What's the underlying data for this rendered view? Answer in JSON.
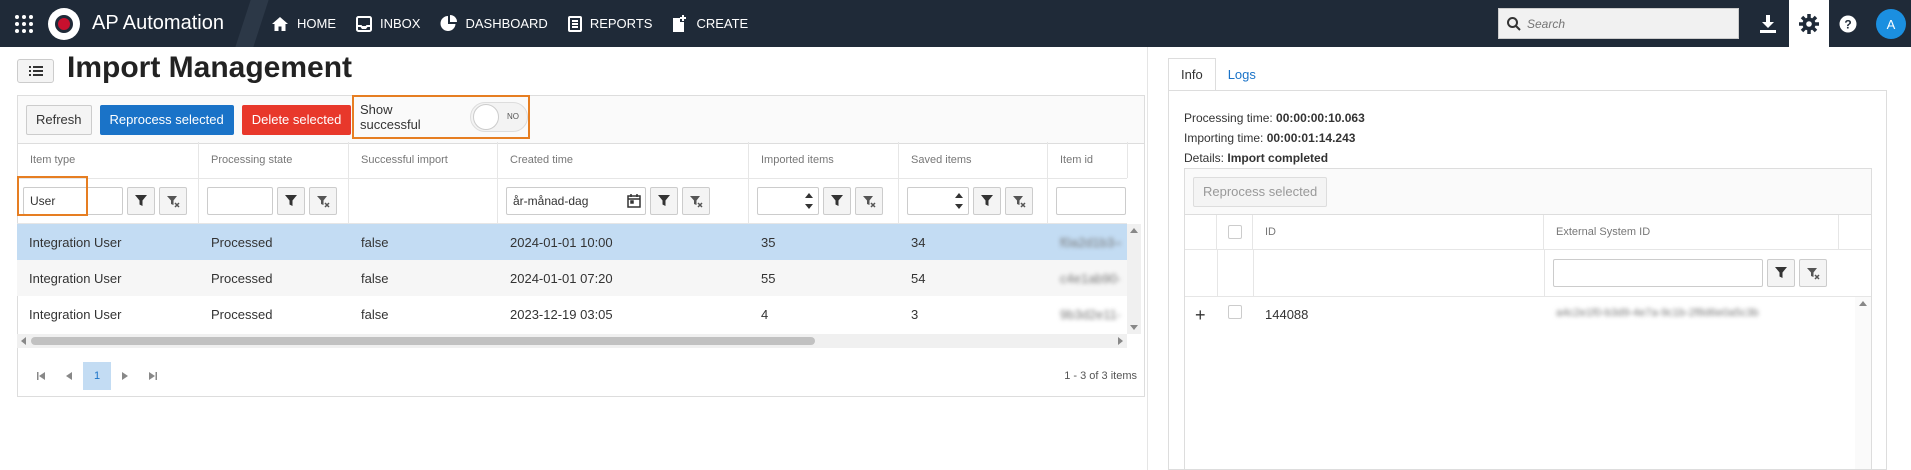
{
  "header": {
    "app_title": "AP Automation",
    "nav": [
      {
        "label": "HOME",
        "icon": "home-icon"
      },
      {
        "label": "INBOX",
        "icon": "inbox-icon"
      },
      {
        "label": "DASHBOARD",
        "icon": "dashboard-icon"
      },
      {
        "label": "REPORTS",
        "icon": "reports-icon"
      },
      {
        "label": "CREATE",
        "icon": "create-icon"
      }
    ],
    "search_placeholder": "Search",
    "avatar_initial": "A"
  },
  "page": {
    "title": "Import Management"
  },
  "toolbar": {
    "refresh": "Refresh",
    "reprocess": "Reprocess selected",
    "delete": "Delete selected",
    "show_successful_label": "Show successful",
    "show_successful_state": "NO"
  },
  "grid": {
    "columns": [
      "Item type",
      "Processing state",
      "Successful import",
      "Created time",
      "Imported items",
      "Saved items",
      "Item id"
    ],
    "filters": {
      "item_type": "User",
      "created_time_placeholder": "år-månad-dag"
    },
    "rows": [
      {
        "item_type": "Integration User",
        "state": "Processed",
        "success": "false",
        "created": "2024-01-01 10:00",
        "imported": "35",
        "saved": "34",
        "item_id": "f0a2d1b3-e",
        "selected": true
      },
      {
        "item_type": "Integration User",
        "state": "Processed",
        "success": "false",
        "created": "2024-01-01 07:20",
        "imported": "55",
        "saved": "54",
        "item_id": "c4e1ab90-7",
        "selected": false
      },
      {
        "item_type": "Integration User",
        "state": "Processed",
        "success": "false",
        "created": "2023-12-19 03:05",
        "imported": "4",
        "saved": "3",
        "item_id": "9b3d2e11-a",
        "selected": false
      }
    ],
    "pager": {
      "current_page": "1",
      "summary": "1 - 3 of 3 items"
    }
  },
  "details": {
    "tabs": [
      "Info",
      "Logs"
    ],
    "processing_label": "Processing time:",
    "processing_value": "00:00:00:10.063",
    "importing_label": "Importing time:",
    "importing_value": "00:00:01:14.243",
    "details_label": "Details:",
    "details_value": "Import completed",
    "reprocess": "Reprocess selected",
    "columns": [
      "ID",
      "External System ID"
    ],
    "rows": [
      {
        "id": "144088",
        "external_id": "a4c2e1f0-b3d9-4e7a-9c1b-2f8d6e0a5c3b"
      }
    ]
  },
  "colors": {
    "topbar": "#1f2a38",
    "accent_blue": "#1a73c8",
    "danger_red": "#e8382b",
    "highlight_orange": "#e67e22",
    "selected_row": "#c3dcf3"
  }
}
